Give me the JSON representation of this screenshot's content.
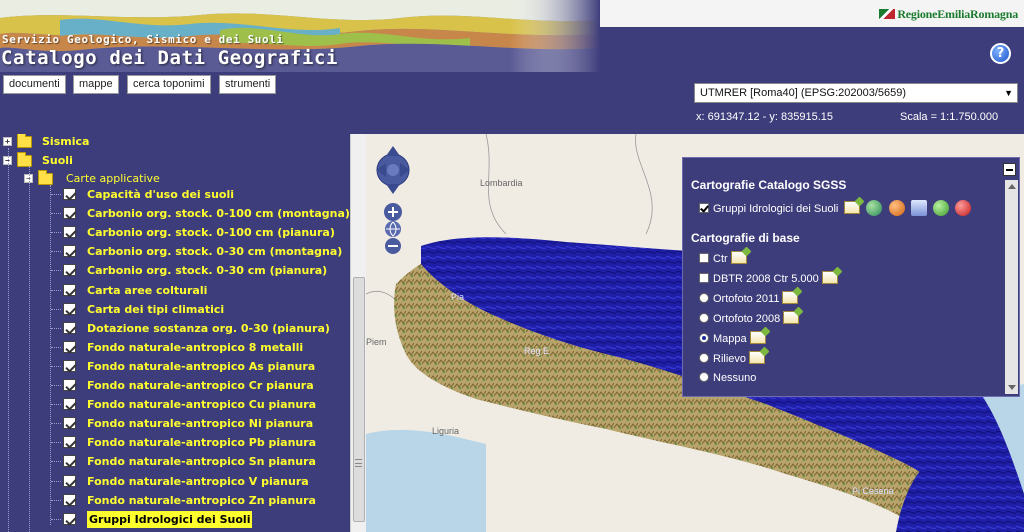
{
  "header": {
    "brand": "RegioneEmiliaRomagna",
    "subtitle": "Servizio Geologico, Sismico e dei Suoli",
    "title": "Catalogo dei Dati Geografici",
    "help_label": "?"
  },
  "toolbar": {
    "buttons": [
      "documenti",
      "mappe",
      "cerca toponimi",
      "strumenti"
    ],
    "projection": "UTMRER [Roma40] (EPSG:202003/5659)",
    "coords": "x: 691347.12 - y: 835915.15",
    "scale": "Scala = 1:1.750.000"
  },
  "tree": {
    "sismica": "Sismica",
    "suoli": "Suoli",
    "carte_applicative": "Carte applicative",
    "layers": [
      "Capacità d'uso dei suoli",
      "Carbonio org. stock. 0-100 cm (montagna)",
      "Carbonio org. stock. 0-100 cm (pianura)",
      "Carbonio org. stock. 0-30 cm (montagna)",
      "Carbonio org. stock. 0-30 cm (pianura)",
      "Carta aree colturali",
      "Carta dei tipi climatici",
      "Dotazione sostanza org. 0-30 (pianura)",
      "Fondo naturale-antropico 8 metalli",
      "Fondo naturale-antropico As pianura",
      "Fondo naturale-antropico Cr pianura",
      "Fondo naturale-antropico Cu pianura",
      "Fondo naturale-antropico Ni pianura",
      "Fondo naturale-antropico Pb pianura",
      "Fondo naturale-antropico Sn pianura",
      "Fondo naturale-antropico V pianura",
      "Fondo naturale-antropico Zn pianura",
      "Gruppi Idrologici dei Suoli"
    ],
    "selected_index": 17
  },
  "map": {
    "labels": [
      "Lombardia",
      "Pia",
      "Piem",
      "Reg E",
      "Liguria",
      "Bo",
      "Pi Cesena"
    ]
  },
  "panel": {
    "sgss_title": "Cartografie Catalogo SGSS",
    "sgss_layer": "Gruppi Idrologici dei Suoli",
    "base_title": "Cartografie di base",
    "base_layers": [
      {
        "label": "Ctr",
        "type": "checkbox",
        "checked": false
      },
      {
        "label": "DBTR 2008 Ctr 5.000",
        "type": "checkbox",
        "checked": false
      },
      {
        "label": "Ortofoto 2011",
        "type": "radio",
        "checked": false
      },
      {
        "label": "Ortofoto 2008",
        "type": "radio",
        "checked": false
      },
      {
        "label": "Mappa",
        "type": "radio",
        "checked": true
      },
      {
        "label": "Rilievo",
        "type": "radio",
        "checked": false
      },
      {
        "label": "Nessuno",
        "type": "radio",
        "checked": false
      }
    ]
  },
  "colors": {
    "navy": "#3e3d7c",
    "tree_text": "#ffff2e",
    "river": "#1a1a9e"
  }
}
